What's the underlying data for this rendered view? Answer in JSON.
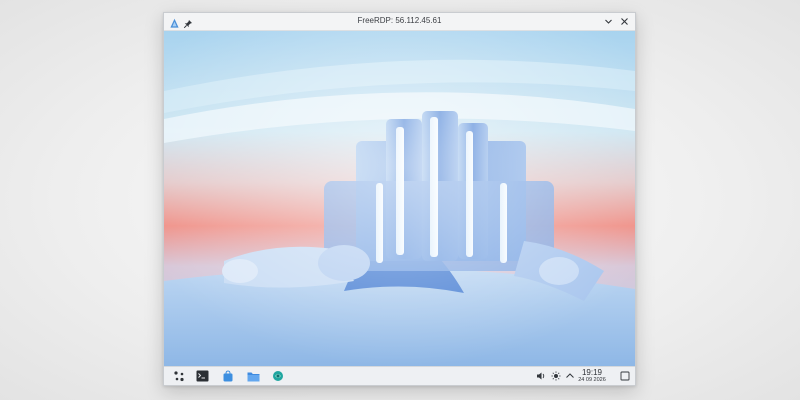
{
  "window": {
    "title": "FreeRDP: 56.112.45.61"
  },
  "icons": {
    "app": "freerdp-icon",
    "pin": "pin-icon",
    "minimize": "chevron-down-icon",
    "close": "close-icon"
  },
  "taskbar": {
    "launchers": [
      {
        "name": "application-launcher",
        "icon": "app-launcher-icon"
      },
      {
        "name": "terminal",
        "icon": "terminal-icon"
      },
      {
        "name": "software-store",
        "icon": "store-bag-icon"
      },
      {
        "name": "file-manager",
        "icon": "folder-icon"
      },
      {
        "name": "browser",
        "icon": "browser-icon"
      }
    ],
    "tray": {
      "volume_icon": "speaker-icon",
      "brightness_icon": "sun-icon",
      "expand_icon": "chevron-up-icon"
    },
    "clock": {
      "time": "19:19",
      "date": "24 09 2026"
    }
  },
  "colors": {
    "accent": "#3d7fe0",
    "taskbar": "#eef0f3"
  }
}
